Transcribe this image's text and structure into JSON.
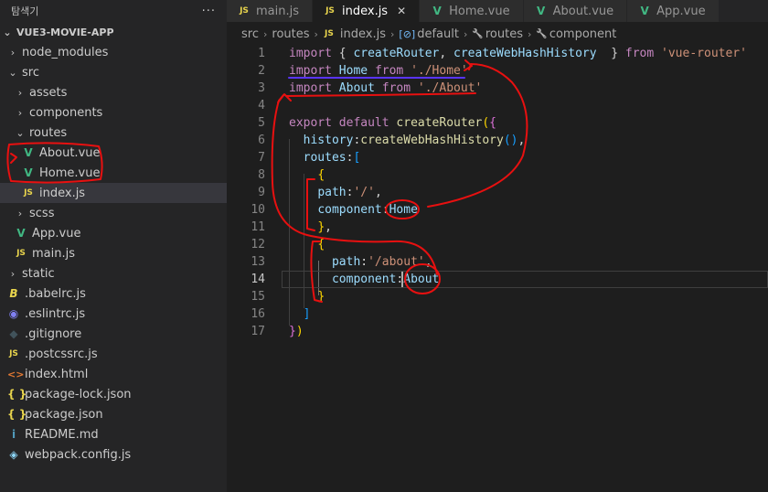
{
  "explorer": {
    "title": "탐색기",
    "more": "···",
    "root": "VUE3-MOVIE-APP",
    "items": [
      {
        "label": "node_modules",
        "kind": "folder",
        "open": false,
        "depth": 1
      },
      {
        "label": "src",
        "kind": "folder",
        "open": true,
        "depth": 1
      },
      {
        "label": "assets",
        "kind": "folder",
        "open": false,
        "depth": 2
      },
      {
        "label": "components",
        "kind": "folder",
        "open": false,
        "depth": 2
      },
      {
        "label": "routes",
        "kind": "folder",
        "open": true,
        "depth": 2
      },
      {
        "label": "About.vue",
        "kind": "vue",
        "depth": 3
      },
      {
        "label": "Home.vue",
        "kind": "vue",
        "depth": 3
      },
      {
        "label": "index.js",
        "kind": "js",
        "depth": 3,
        "active": true
      },
      {
        "label": "scss",
        "kind": "folder",
        "open": false,
        "depth": 2
      },
      {
        "label": "App.vue",
        "kind": "vue",
        "depth": 2
      },
      {
        "label": "main.js",
        "kind": "js",
        "depth": 2
      },
      {
        "label": "static",
        "kind": "folder",
        "open": false,
        "depth": 1
      },
      {
        "label": ".babelrc.js",
        "kind": "babel",
        "depth": 1
      },
      {
        "label": ".eslintrc.js",
        "kind": "eslint",
        "depth": 1
      },
      {
        "label": ".gitignore",
        "kind": "git",
        "depth": 1
      },
      {
        "label": ".postcssrc.js",
        "kind": "js",
        "depth": 1
      },
      {
        "label": "index.html",
        "kind": "html",
        "depth": 1
      },
      {
        "label": "package-lock.json",
        "kind": "json",
        "depth": 1
      },
      {
        "label": "package.json",
        "kind": "json",
        "depth": 1
      },
      {
        "label": "README.md",
        "kind": "info",
        "depth": 1
      },
      {
        "label": "webpack.config.js",
        "kind": "webpack",
        "depth": 1
      }
    ]
  },
  "icons": {
    "js": "JS",
    "vue": "V",
    "json": "{ }",
    "html": "<>",
    "info": "i",
    "babel": "B",
    "eslint": "◉",
    "git": "◆",
    "webpack": "◈",
    "chevron_right": "›",
    "chevron_down": "⌄"
  },
  "tabs": [
    {
      "label": "main.js",
      "icon": "js",
      "active": false
    },
    {
      "label": "index.js",
      "icon": "js",
      "active": true,
      "close": "✕"
    },
    {
      "label": "Home.vue",
      "icon": "vue",
      "active": false
    },
    {
      "label": "About.vue",
      "icon": "vue",
      "active": false
    },
    {
      "label": "App.vue",
      "icon": "vue",
      "active": false
    }
  ],
  "breadcrumb": {
    "parts": [
      "src",
      "routes"
    ],
    "file_icon": "JS",
    "file": "index.js",
    "symbols": [
      {
        "icon": "[⊘]",
        "label": "default"
      },
      {
        "icon": "🔧",
        "label": "routes"
      },
      {
        "icon": "🔧",
        "label": "component"
      }
    ]
  },
  "editor": {
    "current_line": 14,
    "lines": [
      [
        [
          "kw",
          "import"
        ],
        [
          "pun",
          " { "
        ],
        [
          "var",
          "createRouter"
        ],
        [
          "pun",
          ", "
        ],
        [
          "var",
          "createWebHashHistory"
        ],
        [
          "pun",
          "  } "
        ],
        [
          "kw",
          "from"
        ],
        [
          "pun",
          " "
        ],
        [
          "str",
          "'vue-router'"
        ]
      ],
      [
        [
          "kw",
          "import"
        ],
        [
          "pun",
          " "
        ],
        [
          "var",
          "Home"
        ],
        [
          "pun",
          " "
        ],
        [
          "kw",
          "from"
        ],
        [
          "pun",
          " "
        ],
        [
          "str",
          "'./Home'"
        ]
      ],
      [
        [
          "kw",
          "import"
        ],
        [
          "pun",
          " "
        ],
        [
          "var",
          "About"
        ],
        [
          "pun",
          " "
        ],
        [
          "kw",
          "from"
        ],
        [
          "pun",
          " "
        ],
        [
          "str",
          "'./About'"
        ]
      ],
      [],
      [
        [
          "kw",
          "export"
        ],
        [
          "pun",
          " "
        ],
        [
          "kw",
          "default"
        ],
        [
          "pun",
          " "
        ],
        [
          "fn",
          "createRouter"
        ],
        [
          "brk1",
          "("
        ],
        [
          "brk2",
          "{"
        ]
      ],
      [
        [
          "pun",
          "  "
        ],
        [
          "var",
          "history"
        ],
        [
          "pun",
          ":"
        ],
        [
          "fn",
          "createWebHashHistory"
        ],
        [
          "brk3",
          "()"
        ],
        [
          "pun",
          ","
        ]
      ],
      [
        [
          "pun",
          "  "
        ],
        [
          "var",
          "routes"
        ],
        [
          "pun",
          ":"
        ],
        [
          "brk3",
          "["
        ]
      ],
      [
        [
          "pun",
          "    "
        ],
        [
          "brk1",
          "{"
        ]
      ],
      [
        [
          "pun",
          "    "
        ],
        [
          "var",
          "path"
        ],
        [
          "pun",
          ":"
        ],
        [
          "str",
          "'/'"
        ],
        [
          "pun",
          ","
        ]
      ],
      [
        [
          "pun",
          "    "
        ],
        [
          "var",
          "component"
        ],
        [
          "pun",
          ":"
        ],
        [
          "var",
          "Home"
        ]
      ],
      [
        [
          "pun",
          "    "
        ],
        [
          "brk1",
          "}"
        ],
        [
          "pun",
          ","
        ]
      ],
      [
        [
          "pun",
          "    "
        ],
        [
          "brk1",
          "{"
        ]
      ],
      [
        [
          "pun",
          "      "
        ],
        [
          "var",
          "path"
        ],
        [
          "pun",
          ":"
        ],
        [
          "str",
          "'/about'"
        ],
        [
          "pun",
          ","
        ]
      ],
      [
        [
          "pun",
          "      "
        ],
        [
          "var",
          "component"
        ],
        [
          "pun",
          ":"
        ],
        [
          "var",
          "About"
        ]
      ],
      [
        [
          "pun",
          "    "
        ],
        [
          "brk1",
          "}"
        ]
      ],
      [
        [
          "pun",
          "  "
        ],
        [
          "brk3",
          "]"
        ]
      ],
      [
        [
          "brk2",
          "}"
        ],
        [
          "brk1",
          ")"
        ]
      ]
    ]
  },
  "colors": {
    "annotation": "#e81010",
    "annotation_underline": "#5a34ff"
  }
}
